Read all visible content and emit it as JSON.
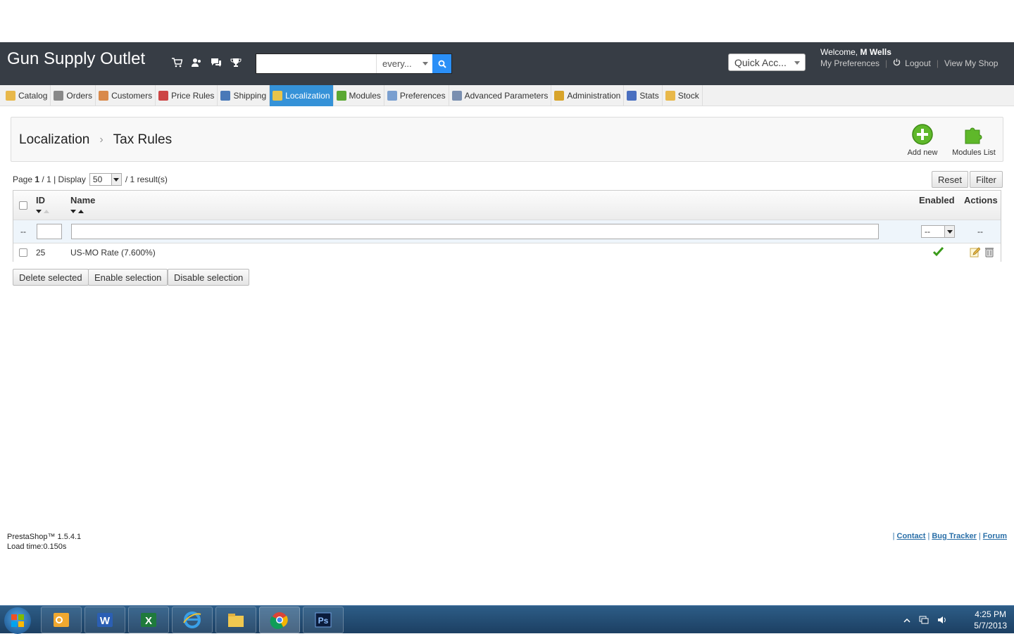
{
  "header": {
    "shop_name": "Gun Supply Outlet",
    "search_scope": "every...",
    "quick_access": "Quick Acc...",
    "welcome_prefix": "Welcome,",
    "user_name": "M Wells",
    "links": {
      "preferences": "My Preferences",
      "logout": "Logout",
      "view_shop": "View My Shop"
    },
    "icons": [
      "cart-icon",
      "customers-icon",
      "messages-icon",
      "trophy-icon"
    ]
  },
  "nav": {
    "tabs": [
      {
        "label": "Catalog",
        "icon": "folder-icon",
        "color": "#e8b84a"
      },
      {
        "label": "Orders",
        "icon": "cart-icon",
        "color": "#888888"
      },
      {
        "label": "Customers",
        "icon": "user-icon",
        "color": "#d9894a"
      },
      {
        "label": "Price Rules",
        "icon": "price-rules-icon",
        "color": "#c44"
      },
      {
        "label": "Shipping",
        "icon": "truck-icon",
        "color": "#4a79b8"
      },
      {
        "label": "Localization",
        "icon": "globe-icon",
        "color": "#e8c44a",
        "active": true
      },
      {
        "label": "Modules",
        "icon": "puzzle-icon",
        "color": "#5aa832"
      },
      {
        "label": "Preferences",
        "icon": "preferences-icon",
        "color": "#7a9fd0"
      },
      {
        "label": "Advanced Parameters",
        "icon": "wrench-icon",
        "color": "#7a8fb0"
      },
      {
        "label": "Administration",
        "icon": "key-icon",
        "color": "#d8a42a"
      },
      {
        "label": "Stats",
        "icon": "chart-icon",
        "color": "#4a6fc0"
      },
      {
        "label": "Stock",
        "icon": "stock-icon",
        "color": "#e8b84a"
      }
    ]
  },
  "toolbar": {
    "breadcrumb": [
      "Localization",
      "Tax Rules"
    ],
    "add_new": "Add new",
    "modules_list": "Modules List"
  },
  "list": {
    "page_label": "Page",
    "page_current": "1",
    "page_total": "/ 1 | Display",
    "per_page": "50",
    "results": "/ 1 result(s)",
    "reset": "Reset",
    "filter": "Filter",
    "columns": {
      "id": "ID",
      "name": "Name",
      "enabled": "Enabled",
      "actions": "Actions"
    },
    "filter_row": {
      "dash_left": "--",
      "enabled_select": "--",
      "dash_right": "--"
    },
    "rows": [
      {
        "id": "25",
        "name": "US-MO Rate (7.600%)",
        "enabled": true
      }
    ],
    "bulk": {
      "delete": "Delete selected",
      "enable": "Enable selection",
      "disable": "Disable selection"
    }
  },
  "footer": {
    "version": "PrestaShop™ 1.5.4.1",
    "load_time": "Load time:0.150s",
    "links": [
      "Contact",
      "Bug Tracker",
      "Forum"
    ]
  },
  "taskbar": {
    "apps": [
      "outlook-icon",
      "word-icon",
      "excel-icon",
      "ie-icon",
      "explorer-icon",
      "chrome-icon",
      "photoshop-icon"
    ],
    "time": "4:25 PM",
    "date": "5/7/2013"
  }
}
